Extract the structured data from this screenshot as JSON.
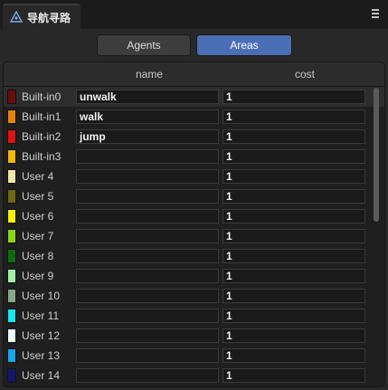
{
  "window": {
    "tab_title": "导航寻路"
  },
  "toggle": {
    "agents_label": "Agents",
    "areas_label": "Areas",
    "selected": "Areas"
  },
  "table": {
    "headers": {
      "name": "name",
      "cost": "cost"
    },
    "rows": [
      {
        "label": "Built-in0",
        "color": "#6b0d0d",
        "name": "unwalk",
        "cost": "1"
      },
      {
        "label": "Built-in1",
        "color": "#e6820e",
        "name": "walk",
        "cost": "1"
      },
      {
        "label": "Built-in2",
        "color": "#e01111",
        "name": "jump",
        "cost": "1"
      },
      {
        "label": "Built-in3",
        "color": "#f2b70c",
        "name": "",
        "cost": "1"
      },
      {
        "label": "User 4",
        "color": "#f3e6a8",
        "name": "",
        "cost": "1"
      },
      {
        "label": "User 5",
        "color": "#6e6a12",
        "name": "",
        "cost": "1"
      },
      {
        "label": "User 6",
        "color": "#f5f10a",
        "name": "",
        "cost": "1"
      },
      {
        "label": "User 7",
        "color": "#8ad41a",
        "name": "",
        "cost": "1"
      },
      {
        "label": "User 8",
        "color": "#0d6b12",
        "name": "",
        "cost": "1"
      },
      {
        "label": "User 9",
        "color": "#a6eea6",
        "name": "",
        "cost": "1"
      },
      {
        "label": "User 10",
        "color": "#85a985",
        "name": "",
        "cost": "1"
      },
      {
        "label": "User 11",
        "color": "#18e6f0",
        "name": "",
        "cost": "1"
      },
      {
        "label": "User 12",
        "color": "#e9fbfb",
        "name": "",
        "cost": "1"
      },
      {
        "label": "User 13",
        "color": "#1aa6e8",
        "name": "",
        "cost": "1"
      },
      {
        "label": "User 14",
        "color": "#12166a",
        "name": "",
        "cost": "1"
      }
    ]
  }
}
